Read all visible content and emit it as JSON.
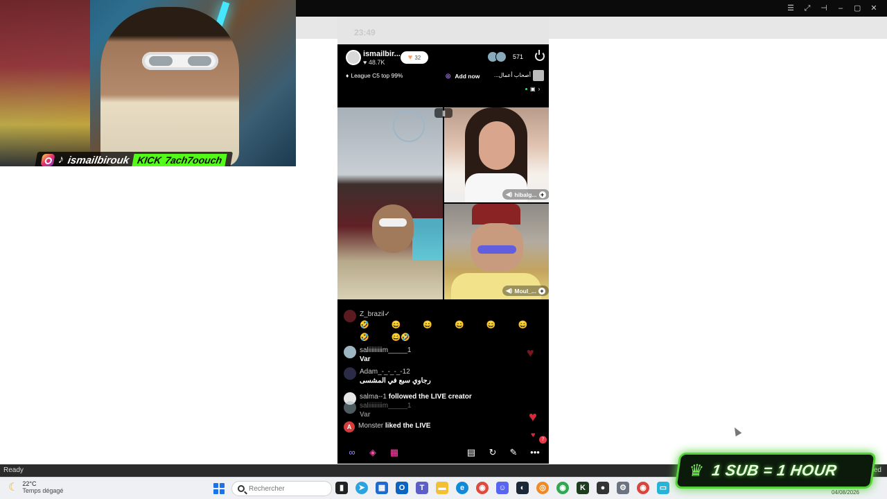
{
  "window": {
    "controls": [
      "☰",
      "⤢",
      "⊣",
      "–",
      "▢",
      "✕"
    ]
  },
  "webcam": {
    "handle": "ismailbirouk",
    "kick_label": "KICK",
    "kick_handle": "7ach7oouch"
  },
  "phone": {
    "time": "23:49",
    "host": {
      "name": "ismailbir...",
      "likes": "48.7K"
    },
    "follow_count": "32",
    "viewer_count": "571",
    "league": "League C5 top 99%",
    "add_now": "Add now",
    "arabic_tag": "...أصحاب أعمال",
    "tiles": [
      {
        "label": "hibalg..."
      },
      {
        "label": "Moul_..."
      }
    ],
    "chat": [
      {
        "user": "Z_brazil✓",
        "emojis": [
          "🤣",
          "😄",
          "😄",
          "😄",
          "😄",
          "😄",
          "🤣",
          "😄🤣"
        ]
      },
      {
        "user": "saliiiiiiiiim_____1",
        "text": "Var"
      },
      {
        "user": "Adam_-_-_-_-12",
        "text": "رجاوي سبع في المشسى"
      },
      {
        "user": "salma--1",
        "text": "followed the LIVE creator"
      },
      {
        "user": "saliiiiiiiiim_____1",
        "text": "Var"
      },
      {
        "user": "Monster",
        "initial": "A",
        "text": "liked the LIVE"
      }
    ],
    "likes_badge": "7",
    "bottom_icons": [
      "loop-icon",
      "gift-icon",
      "grid-icon",
      "film-icon",
      "share-icon",
      "pen-icon",
      "more-icon"
    ]
  },
  "statusbar": {
    "left": "Ready",
    "right": "cted"
  },
  "taskbar": {
    "temp": "22°C",
    "weather": "Temps dégagé",
    "search_placeholder": "Rechercher",
    "date": "04/08/2026"
  },
  "sub_banner": {
    "text": "1 SUB = 1 HOUR"
  }
}
